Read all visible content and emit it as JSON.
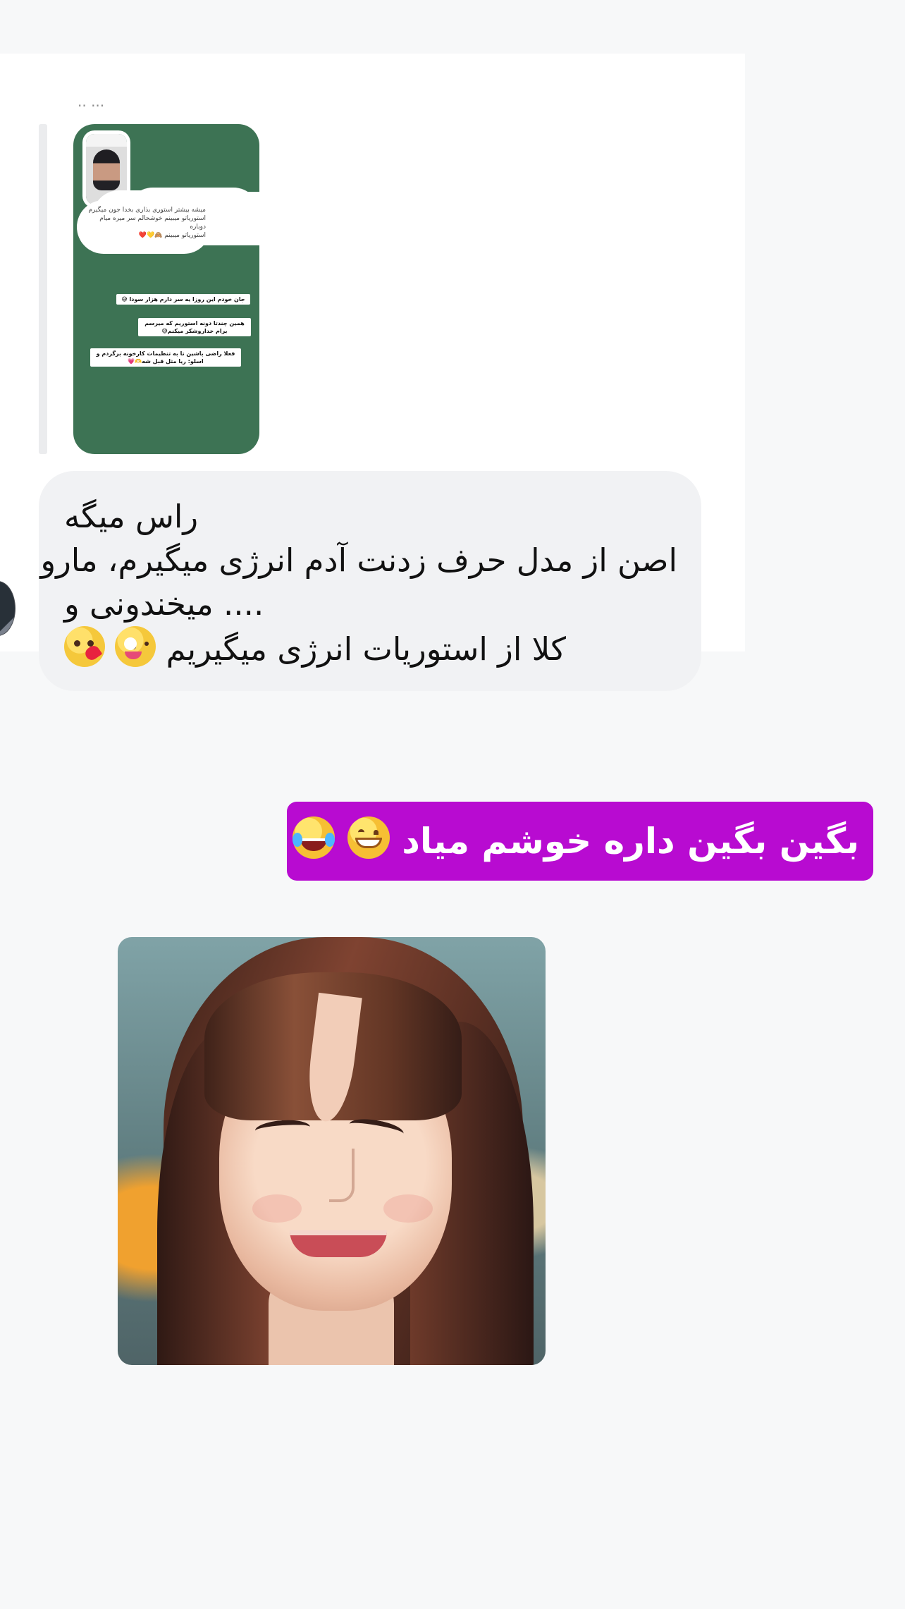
{
  "colors": {
    "page_background": "#f7f8f9",
    "chat_card_background": "#ffffff",
    "received_bubble": "#f1f2f4",
    "sent_bubble": "#b80bd1",
    "story_background": "#3d7354",
    "text_primary": "#111111",
    "sent_text": "#ffffff"
  },
  "story_reply": {
    "cut_text": "... ..",
    "photo_alt": "story-profile-photo",
    "cloud_text": [
      "میشه بیشتر استوری بذاری بخدا جون میگیرم",
      "استوریاتو میبینم خوشحالم سر میره میام دوباره",
      "استوریاتو میبینم 🙈💛❤️"
    ],
    "labels": [
      "جان خودم این روزا یه سر دارم هزار سودا 😅",
      "همین چندتا دونه استوریم که میرسم برام خداروشکر میکنم😅",
      "فعلا راضی باشین تا به تنظیمات کارخونه برگردم و اسلو: ریا مثل قبل شه🫶💗"
    ]
  },
  "received_message": {
    "lines": [
      "راس میگه",
      "اصن از مدل حرف زدنت آدم انرژی میگیرم، مارو",
      "میخندونی و ....",
      "کلا از استوریات انرژی میگیریم"
    ],
    "emoji_names": [
      "winking-face-with-tongue",
      "face-blowing-a-kiss"
    ]
  },
  "sent_message": {
    "text": "بگین بگین داره خوشم میاد",
    "emoji_names": [
      "grinning-face-with-smiling-eyes",
      "face-with-tears-of-joy"
    ]
  },
  "reaction_image": {
    "description": "smiling woman photo"
  }
}
